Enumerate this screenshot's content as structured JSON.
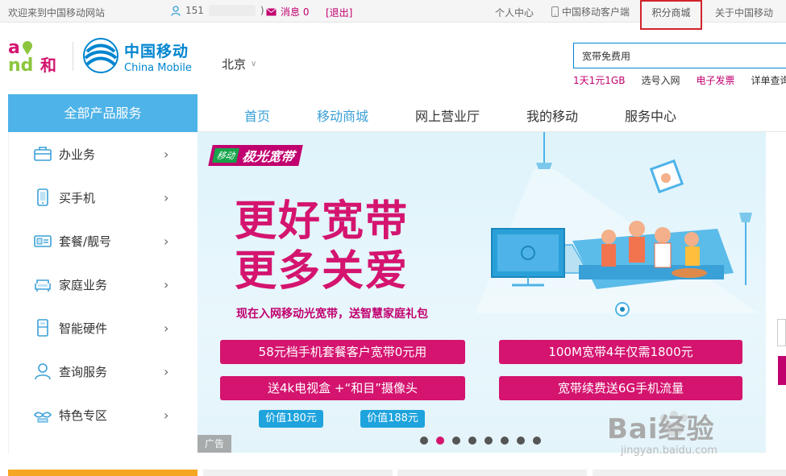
{
  "topbar": {
    "welcome": "欢迎来到中国移动网站",
    "user_prefix": "151",
    "user_suffix": ")",
    "messages": "消息 0",
    "logout": "[退出]",
    "personal_center": "个人中心",
    "client": "中国移动客户端",
    "points_mall": "积分商城",
    "about": "关于中国移动"
  },
  "header": {
    "brand_cn": "中国移动",
    "brand_en": "China Mobile",
    "logo_he": "和",
    "city": "北京"
  },
  "search": {
    "value": "宽带免费用",
    "hotwords": [
      {
        "text": "1天1元1GB",
        "style": "hot"
      },
      {
        "text": "选号入网",
        "style": "norm"
      },
      {
        "text": "电子发票",
        "style": "hot"
      },
      {
        "text": "详单查询",
        "style": "norm"
      }
    ]
  },
  "nav": {
    "all_products": "全部产品服务",
    "tabs": [
      "首页",
      "移动商城",
      "网上营业厅",
      "我的移动",
      "服务中心"
    ]
  },
  "menu": {
    "items": [
      "办业务",
      "买手机",
      "套餐/靓号",
      "家庭业务",
      "智能硬件",
      "查询服务",
      "特色专区"
    ]
  },
  "banner": {
    "ribbon_tag": "移动",
    "ribbon_title": "极光宽带",
    "headline_1": "更好宽带",
    "headline_2": "更多关爱",
    "subline": "现在入网移动光宽带，送智慧家庭礼包",
    "offer_1": "58元档手机套餐客户宽带0元用",
    "offer_2": "100M宽带4年仅需1800元",
    "offer_3": "送4k电视盒 +“和目”摄像头",
    "offer_4": "宽带续费送6G手机流量",
    "price_1": "价值180元",
    "price_2": "价值188元",
    "ad_label": "广告",
    "slide_count": 8,
    "active_slide": 2
  },
  "watermark": {
    "text": "Bai经验",
    "url": "jingyan.baidu.com"
  },
  "colors": {
    "brand_blue": "#0085d0",
    "nav_blue": "#4eb3e8",
    "magenta": "#d4146f",
    "highlight_red": "#d2232a"
  }
}
